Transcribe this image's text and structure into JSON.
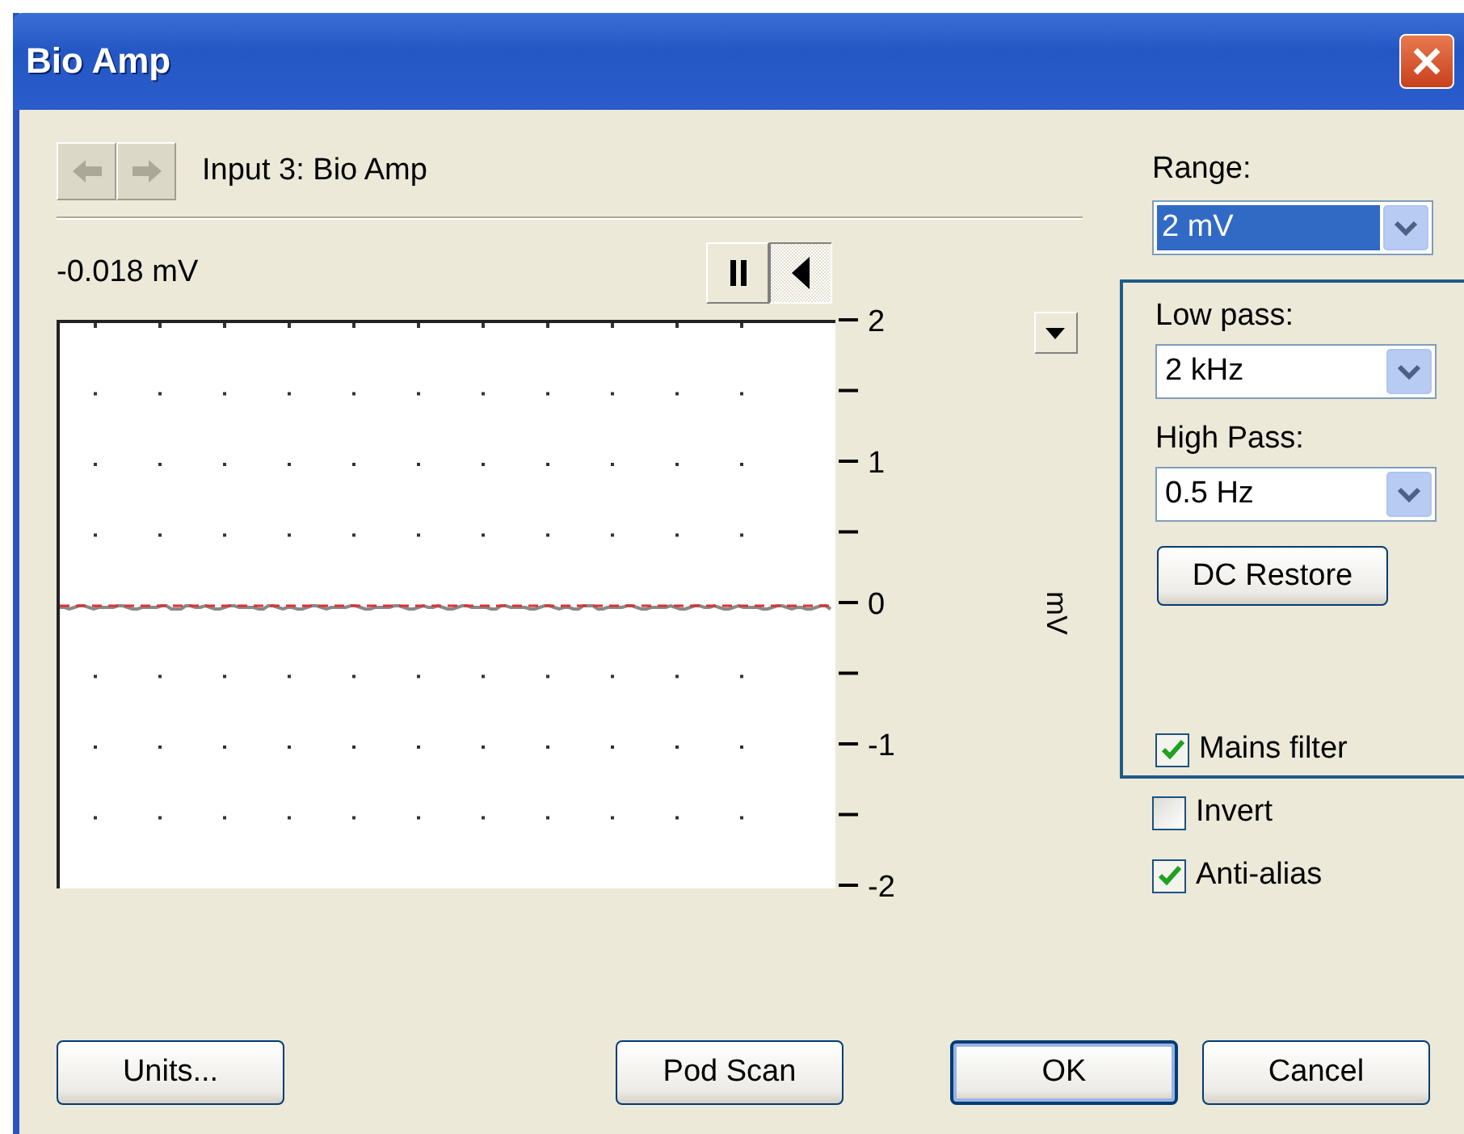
{
  "window": {
    "title": "Bio Amp"
  },
  "nav": {
    "back_disabled": true,
    "forward_disabled": true,
    "input_label": "Input 3: Bio Amp"
  },
  "reading": "-0.018 mV",
  "playback": [
    {
      "kind": "pause",
      "selected": false
    },
    {
      "kind": "play",
      "selected": true
    }
  ],
  "plot": {
    "y_tick_labels": [
      "2",
      "1",
      "0",
      "-1",
      "-2"
    ],
    "unit": "mV"
  },
  "range": {
    "label": "Range:",
    "value": "2 mV",
    "focused": true
  },
  "filters": {
    "low_pass": {
      "label": "Low pass:",
      "value": "2 kHz",
      "focused": false
    },
    "high_pass": {
      "label": "High Pass:",
      "value": "0.5 Hz",
      "focused": false
    },
    "dc_restore": "DC Restore",
    "mains_filter": {
      "label": "Mains filter",
      "checked": true
    }
  },
  "checkboxes": [
    {
      "label": "Invert",
      "checked": false
    },
    {
      "label": "Anti-alias",
      "checked": true
    }
  ],
  "buttons": [
    {
      "label": "Units...",
      "default": false
    },
    {
      "label": "Pod Scan",
      "default": false
    },
    {
      "label": "OK",
      "default": true
    },
    {
      "label": "Cancel",
      "default": false
    }
  ]
}
